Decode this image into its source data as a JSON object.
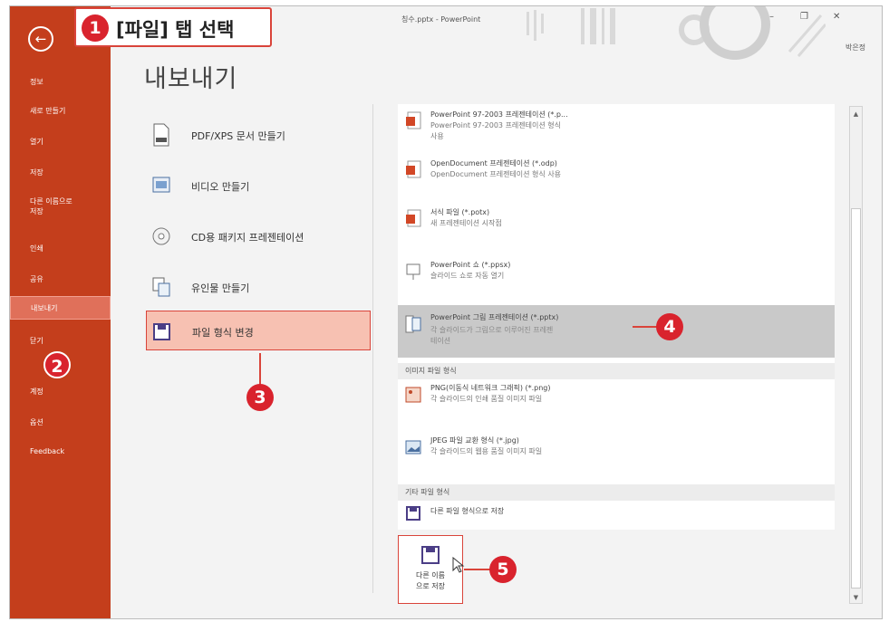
{
  "window": {
    "title": "칭수.pptx - PowerPoint",
    "minimize": "–",
    "restore": "❐",
    "close": "✕",
    "user": "박은정"
  },
  "sidebar": {
    "back_icon": "←",
    "items": [
      {
        "label": "정보"
      },
      {
        "label": "새로 만들기"
      },
      {
        "label": "열기"
      },
      {
        "label": "저장"
      },
      {
        "label": "다른 이름으로\n저장"
      },
      {
        "label": "인쇄"
      },
      {
        "label": "공유"
      },
      {
        "label": "내보내기",
        "active": true
      },
      {
        "label": "닫기"
      },
      {
        "label": "계정"
      },
      {
        "label": "옵션"
      },
      {
        "label": "Feedback"
      }
    ]
  },
  "page_title": "내보내기",
  "export_options": [
    {
      "label": "PDF/XPS 문서 만들기",
      "icon": "pdf-document-icon"
    },
    {
      "label": "비디오 만들기",
      "icon": "video-icon"
    },
    {
      "label": "CD용 패키지 프레젠테이션",
      "icon": "cd-icon"
    },
    {
      "label": "유인물 만들기",
      "icon": "handout-icon"
    },
    {
      "label": "파일 형식 변경",
      "icon": "change-file-type-icon",
      "selected": true
    }
  ],
  "file_types": {
    "items": [
      {
        "title": "PowerPoint 97-2003 프레젠테이션 (*.p...",
        "desc1": "PowerPoint 97-2003 프레젠테이션 형식",
        "desc2": "사용",
        "icon": "ppt-legacy-icon"
      },
      {
        "title": "OpenDocument 프레젠테이션 (*.odp)",
        "desc1": "OpenDocument 프레젠테이션 형식 사용",
        "desc2": "",
        "icon": "odp-icon"
      },
      {
        "title": "서식 파일 (*.potx)",
        "desc1": "새 프레젠테이션 시작점",
        "desc2": "",
        "icon": "template-icon"
      },
      {
        "title": "PowerPoint 쇼 (*.ppsx)",
        "desc1": "슬라이드 쇼로 자동 열기",
        "desc2": "",
        "icon": "slideshow-icon"
      },
      {
        "title": "PowerPoint 그림 프레젠테이션 (*.pptx)",
        "desc1": "각 슬라이드가 그림으로 이루어진 프레젠",
        "desc2": "테이션",
        "icon": "picture-presentation-icon",
        "selected": true
      }
    ],
    "image_section": "이미지 파일 형식",
    "image_items": [
      {
        "title": "PNG(이동식 네트워크 그래픽) (*.png)",
        "desc1": "각 슬라이드의 인쇄 품질 이미지 파일",
        "icon": "png-icon"
      },
      {
        "title": "JPEG 파일 교환 형식 (*.jpg)",
        "desc1": "각 슬라이드의 웹용 품질 이미지 파일",
        "icon": "jpeg-icon"
      }
    ],
    "other_section": "기타 파일 형식",
    "other_item": {
      "title": "다른 파일 형식으로 저장",
      "icon": "save-as-icon"
    }
  },
  "save_as_button": {
    "line1": "다른 이름",
    "line2": "으로 저장"
  },
  "callouts": {
    "step1": "1",
    "step1_text": "[파일] 탭 선택",
    "step2": "2",
    "step3": "3",
    "step4": "4",
    "step5": "5"
  },
  "colors": {
    "sidebar": "#c43e1c",
    "accent": "#d9232d",
    "highlight": "#f7c1b2"
  }
}
